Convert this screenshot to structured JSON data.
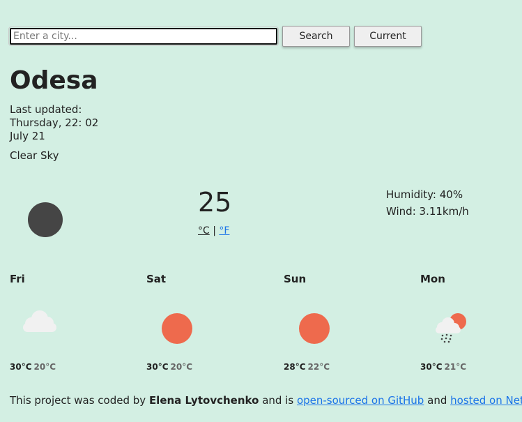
{
  "search": {
    "placeholder": "Enter a city...",
    "search_label": "Search",
    "current_label": "Current"
  },
  "city": "Odesa",
  "updated": {
    "label": "Last updated:",
    "line1": "Thursday, 22: 02",
    "line2": "July 21"
  },
  "description": "Clear Sky",
  "current": {
    "icon": "moon-icon",
    "temperature": "25",
    "unit_c": "°C",
    "separator": "|",
    "unit_f": "°F",
    "humidity": "Humidity: 40%",
    "wind": "Wind: 3.11km/h"
  },
  "forecast": [
    {
      "day": "Fri",
      "icon": "cloud-icon",
      "max": "30°C",
      "min": "20°C"
    },
    {
      "day": "Sat",
      "icon": "sun-icon",
      "max": "30°C",
      "min": "20°C"
    },
    {
      "day": "Sun",
      "icon": "sun-icon",
      "max": "28°C",
      "min": "22°C"
    },
    {
      "day": "Mon",
      "icon": "rain-sun-icon",
      "max": "30°C",
      "min": "21°C"
    }
  ],
  "footer": {
    "prefix": "This project was coded by",
    "author": "Elena Lytovchenko",
    "middle": "and is",
    "link1": "open-sourced on GitHub",
    "and": "and",
    "link2": "hosted on Netlify"
  },
  "colors": {
    "background": "#d3efe3",
    "sun": "#ee6a4d",
    "moon": "#454545",
    "link": "#1a73e8"
  }
}
